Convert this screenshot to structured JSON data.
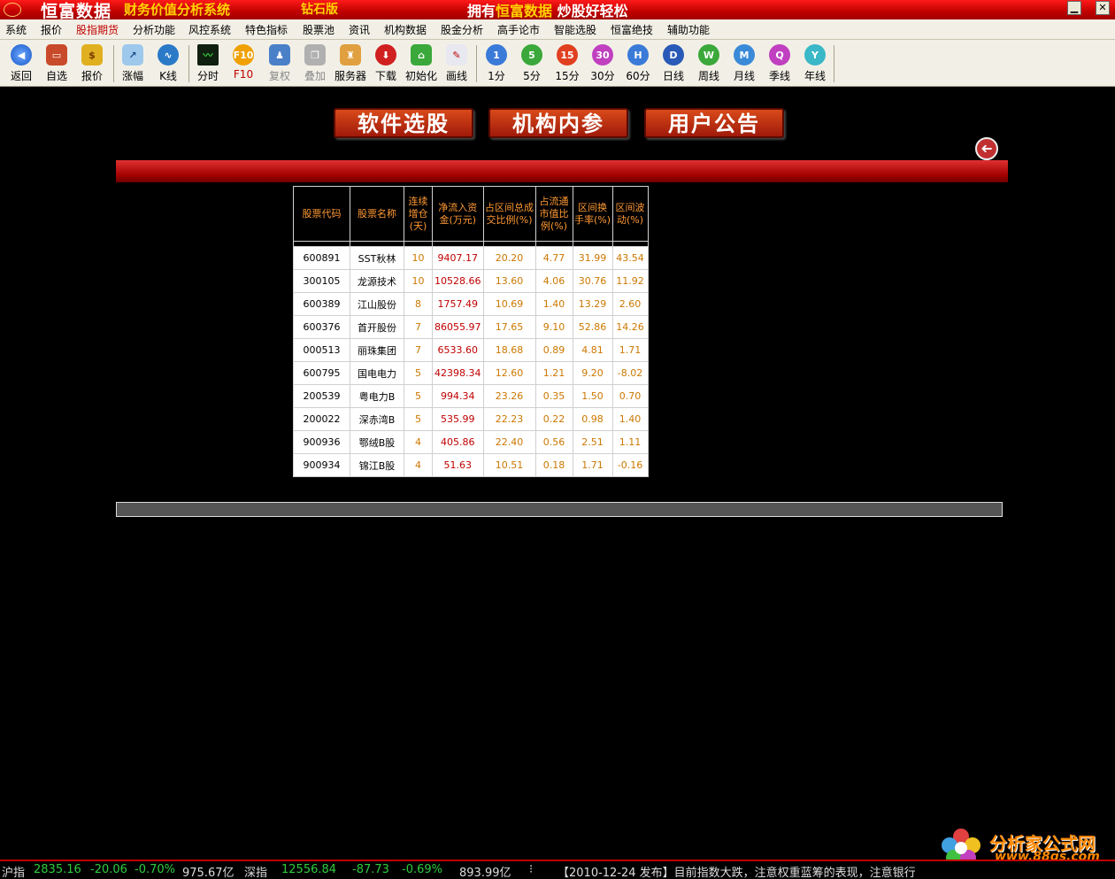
{
  "title": {
    "brand": "恒富数据",
    "subtitle": "财务价值分析系统",
    "edition": "钻石版",
    "slogan_pre": "拥有",
    "slogan_brand": "恒富数据",
    "slogan_post": "炒股好轻松"
  },
  "window_buttons": {
    "minimize": "▁",
    "close": "✕"
  },
  "menu": [
    "系统",
    "报价",
    "股指期货",
    "分析功能",
    "风控系统",
    "特色指标",
    "股票池",
    "资讯",
    "机构数据",
    "股金分析",
    "高手论市",
    "智能选股",
    "恒富绝技",
    "辅助功能"
  ],
  "toolbar": {
    "back": "返回",
    "favorites": "自选",
    "quote": "报价",
    "rise": "涨幅",
    "kline": "K线",
    "intraday": "分时",
    "f10": "F10",
    "restore": "复权",
    "overlay": "叠加",
    "server": "服务器",
    "download": "下载",
    "init": "初始化",
    "draw": "画线",
    "m1": "1分",
    "m5": "5分",
    "m15": "15分",
    "m30": "30分",
    "m60": "60分",
    "day": "日线",
    "week": "周线",
    "month": "月线",
    "season": "季线",
    "year": "年线",
    "icon_text": {
      "f10": "F10",
      "m1": "1",
      "m5": "5",
      "m15": "15",
      "m30": "30",
      "m60": "H",
      "day": "D",
      "week": "W",
      "month": "M",
      "season": "Q",
      "year": "Y"
    }
  },
  "nav_buttons": [
    "软件选股",
    "机构内参",
    "用户公告"
  ],
  "back_arrow": "➜",
  "table": {
    "headers": [
      "股票代码",
      "股票名称",
      "连续增仓(天)",
      "净流入资金(万元)",
      "占区间总成交比例(%)",
      "占流通市值比例(%)",
      "区间换手率(%)",
      "区间波动(%)"
    ],
    "rows": [
      [
        "600891",
        "SST秋林",
        "10",
        "9407.17",
        "20.20",
        "4.77",
        "31.99",
        "43.54"
      ],
      [
        "300105",
        "龙源技术",
        "10",
        "10528.66",
        "13.60",
        "4.06",
        "30.76",
        "11.92"
      ],
      [
        "600389",
        "江山股份",
        "8",
        "1757.49",
        "10.69",
        "1.40",
        "13.29",
        "2.60"
      ],
      [
        "600376",
        "首开股份",
        "7",
        "86055.97",
        "17.65",
        "9.10",
        "52.86",
        "14.26"
      ],
      [
        "000513",
        "丽珠集团",
        "7",
        "6533.60",
        "18.68",
        "0.89",
        "4.81",
        "1.71"
      ],
      [
        "600795",
        "国电电力",
        "5",
        "42398.34",
        "12.60",
        "1.21",
        "9.20",
        "-8.02"
      ],
      [
        "200539",
        "粤电力B",
        "5",
        "994.34",
        "23.26",
        "0.35",
        "1.50",
        "0.70"
      ],
      [
        "200022",
        "深赤湾B",
        "5",
        "535.99",
        "22.23",
        "0.22",
        "0.98",
        "1.40"
      ],
      [
        "900936",
        "鄂绒B股",
        "4",
        "405.86",
        "22.40",
        "0.56",
        "2.51",
        "1.11"
      ],
      [
        "900934",
        "锦江B股",
        "4",
        "51.63",
        "10.51",
        "0.18",
        "1.71",
        "-0.16"
      ]
    ]
  },
  "watermark": {
    "title": "分析家公式网",
    "url": "www.88gs.com"
  },
  "status": {
    "sh_label": "沪指",
    "sh_index": "2835.16",
    "sh_change": "-20.06",
    "sh_pct": "-0.70%",
    "sh_vol": "975.67亿",
    "sz_label": "深指",
    "sz_index": "12556.84",
    "sz_change": "-87.73",
    "sz_pct": "-0.69%",
    "sz_vol": "893.99亿",
    "sep": "⁝",
    "news": "【2010-12-24 发布】目前指数大跌，注意权重蓝筹的表现，注意银行"
  },
  "colors": {
    "title_red": "#c00000",
    "header_orange": "#ff9933",
    "flow_red": "#c00000",
    "value_orange": "#cc7700",
    "gold": "#ffd200",
    "up_green": "#2ecc40"
  }
}
